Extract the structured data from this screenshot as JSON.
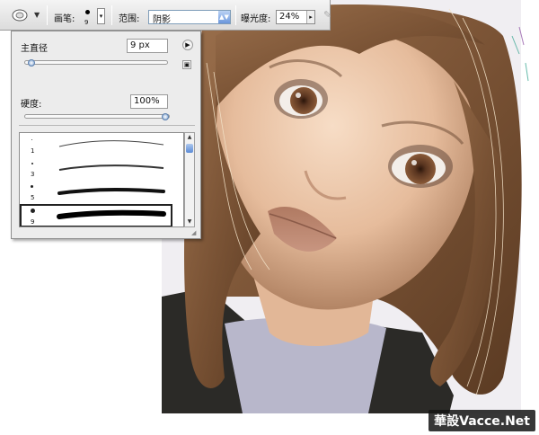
{
  "options_bar": {
    "tool_icon": "dodge-burn-icon",
    "brush_label": "画笔:",
    "brush_size": "9",
    "range_label": "范围:",
    "range_value": "阴影",
    "exposure_label": "曝光度:",
    "exposure_value": "24%",
    "airbrush_icon": "airbrush-icon"
  },
  "brush_panel": {
    "master_diameter_label": "主直径",
    "master_diameter_value": "9 px",
    "master_diameter_fraction": 0.02,
    "hardness_label": "硬度:",
    "hardness_value": "100%",
    "hardness_fraction": 1.0,
    "presets": [
      {
        "size": "1",
        "selected": false
      },
      {
        "size": "3",
        "selected": false
      },
      {
        "size": "5",
        "selected": false
      },
      {
        "size": "9",
        "selected": true
      }
    ]
  },
  "watermark": "華設Vacce.Net",
  "colors": {
    "panel_bg": "#ececec",
    "hair": "#7a5436",
    "skin": "#e9c3a5",
    "shirt": "#b8b8c8",
    "jacket": "#2c2b28"
  }
}
